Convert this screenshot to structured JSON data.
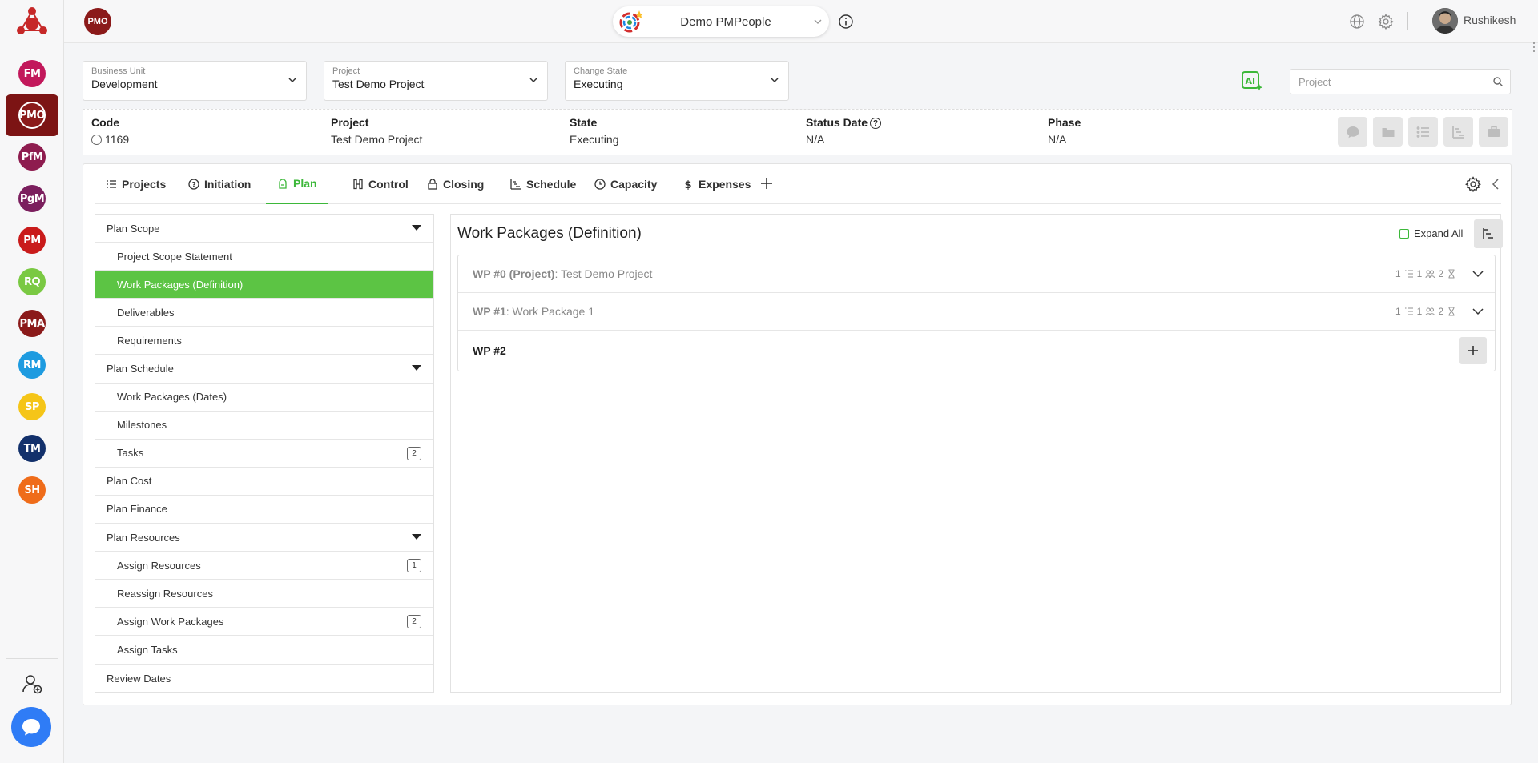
{
  "top": {
    "org_badge": "PMO",
    "org_name": "Demo PMPeople",
    "user_name": "Rushikesh"
  },
  "rail": {
    "items": [
      {
        "label": "FM",
        "color": "#c2185b"
      },
      {
        "label": "PMO",
        "color": "#8b1a1a"
      },
      {
        "label": "PfM",
        "color": "#8e1c4f"
      },
      {
        "label": "PgM",
        "color": "#7b1f5e"
      },
      {
        "label": "PM",
        "color": "#c91b1b"
      },
      {
        "label": "RQ",
        "color": "#7ac943"
      },
      {
        "label": "PMA",
        "color": "#8b1a1a"
      },
      {
        "label": "RM",
        "color": "#1e9be0"
      },
      {
        "label": "SP",
        "color": "#f5c518"
      },
      {
        "label": "TM",
        "color": "#12306b"
      },
      {
        "label": "SH",
        "color": "#ef6c1a"
      }
    ]
  },
  "selectors": {
    "business_unit": {
      "label": "Business Unit",
      "value": "Development"
    },
    "project": {
      "label": "Project",
      "value": "Test Demo Project"
    },
    "change_state": {
      "label": "Change State",
      "value": "Executing"
    }
  },
  "search": {
    "placeholder": "Project"
  },
  "info": {
    "code_label": "Code",
    "code_value": "1169",
    "project_label": "Project",
    "project_value": "Test Demo Project",
    "state_label": "State",
    "state_value": "Executing",
    "status_date_label": "Status Date",
    "status_date_value": "N/A",
    "phase_label": "Phase",
    "phase_value": "N/A"
  },
  "tabs": {
    "projects": "Projects",
    "initiation": "Initiation",
    "plan": "Plan",
    "control": "Control",
    "closing": "Closing",
    "schedule": "Schedule",
    "capacity": "Capacity",
    "expenses": "Expenses"
  },
  "menu": {
    "plan_scope": "Plan Scope",
    "project_scope_statement": "Project Scope Statement",
    "work_packages_definition": "Work Packages (Definition)",
    "deliverables": "Deliverables",
    "requirements": "Requirements",
    "plan_schedule": "Plan Schedule",
    "work_packages_dates": "Work Packages (Dates)",
    "milestones": "Milestones",
    "tasks": "Tasks",
    "tasks_count": "2",
    "plan_cost": "Plan Cost",
    "plan_finance": "Plan Finance",
    "plan_resources": "Plan Resources",
    "assign_resources": "Assign Resources",
    "assign_resources_count": "1",
    "reassign_resources": "Reassign Resources",
    "assign_work_packages": "Assign Work Packages",
    "assign_work_packages_count": "2",
    "assign_tasks": "Assign Tasks",
    "review_dates": "Review Dates"
  },
  "panel": {
    "title": "Work Packages (Definition)",
    "expand_all": "Expand All",
    "work_packages": [
      {
        "id": "WP #0 (Project)",
        "name": ": Test Demo Project",
        "subs": "1",
        "deliv": "1",
        "res": "2"
      },
      {
        "id": "WP #1",
        "name": ": Work Package 1",
        "subs": "1",
        "deliv": "1",
        "res": "2"
      },
      {
        "id": "WP #2"
      }
    ]
  },
  "colors": {
    "accent": "#3db83a",
    "active_menu": "#5cc444",
    "brand": "#8b1a1a"
  }
}
